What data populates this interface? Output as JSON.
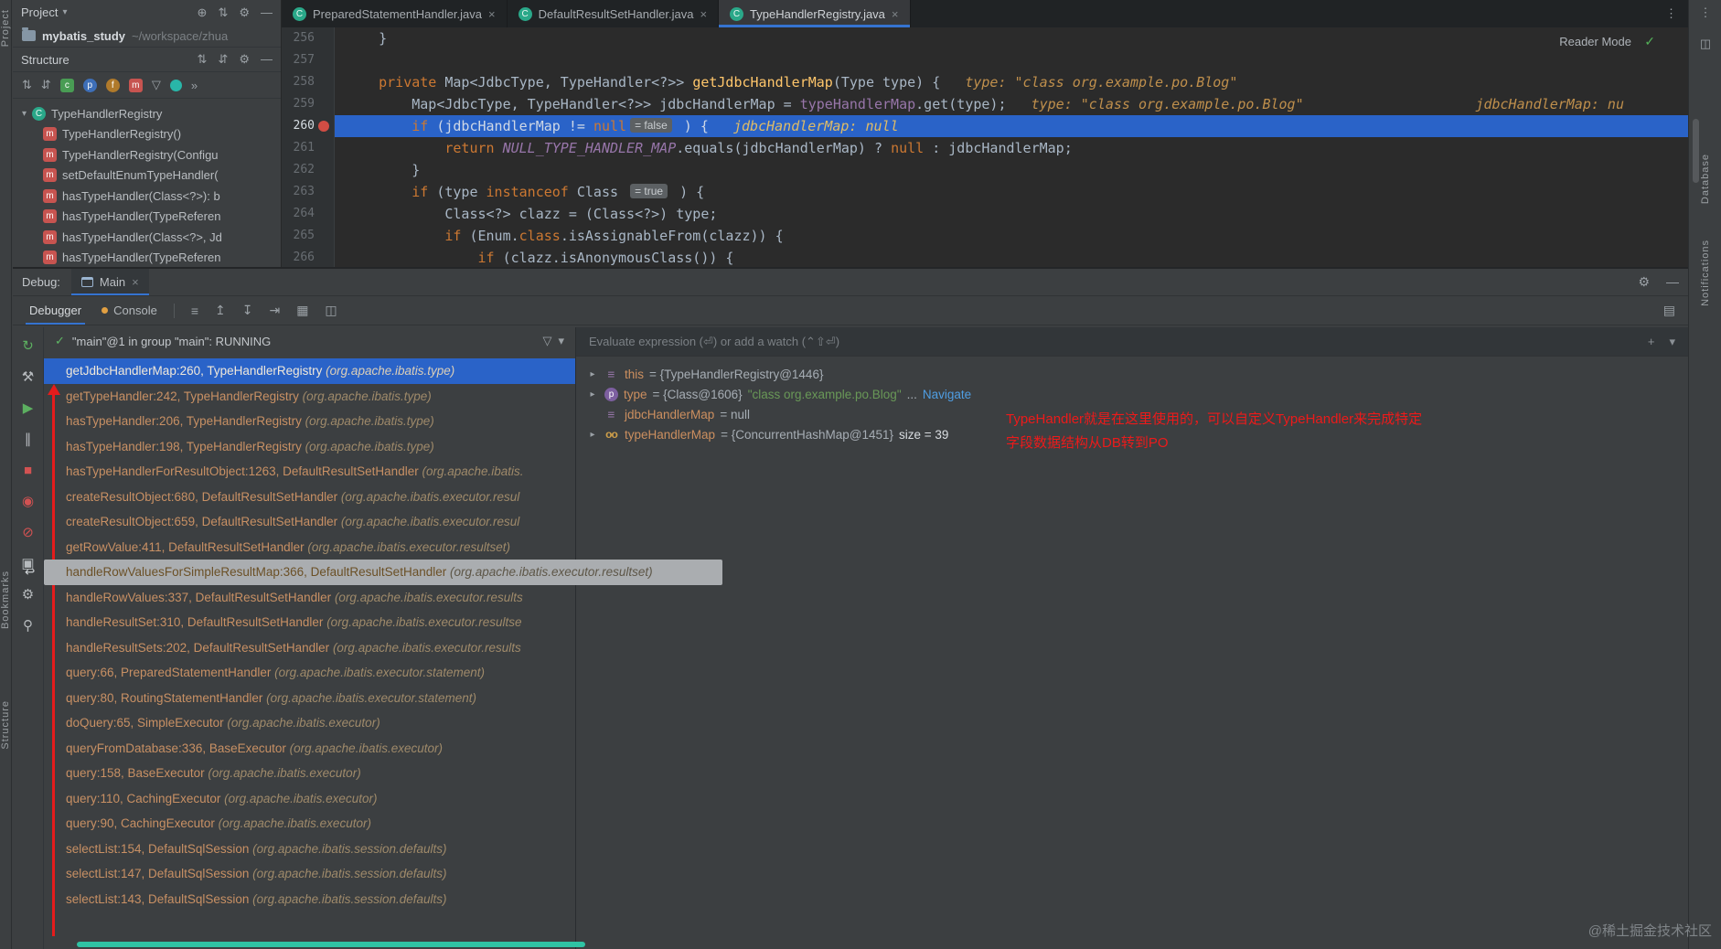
{
  "icons": {
    "caret_down": "▾",
    "caret_right": "▸",
    "crosshair": "⊕",
    "sort": "⇅",
    "sort_alt": "⇵",
    "gear": "⚙",
    "minus": "—",
    "close": "×",
    "dots": "⋮",
    "more": "»",
    "filter": "▽",
    "check": "✓",
    "rerun": "↻",
    "build": "⚒",
    "resume": "▶",
    "pause": "∥",
    "stop": "■",
    "breakpoints": "◉",
    "mute": "⊘",
    "camera": "▣",
    "pin": "⚲",
    "hamburger": "≡",
    "up_bar": "↥",
    "down_bar": "↧",
    "tab_key": "⇥",
    "grid": "▦",
    "split": "◫",
    "layout": "▤",
    "plus": "+",
    "back": "↩",
    "badge_c": "c",
    "badge_p": "p",
    "badge_f": "f",
    "badge_m": "m",
    "class_letter": "C",
    "method_letter": "m",
    "param_letter": "p",
    "watch": "oo",
    "field_bars": "≡"
  },
  "left_stripe": {
    "top_label": "Project",
    "mid_label": "Bookmarks",
    "bottom_label": "Structure"
  },
  "right_stripe": {
    "label_database": "Database",
    "label_notifications": "Notifications"
  },
  "project": {
    "header_title": "Project",
    "root_name": "mybatis_study",
    "root_path": "~/workspace/zhua",
    "structure_title": "Structure",
    "tree_class": "TypeHandlerRegistry",
    "tree": {
      "methods": [
        "TypeHandlerRegistry()",
        "TypeHandlerRegistry(Configu",
        "setDefaultEnumTypeHandler(",
        "hasTypeHandler(Class<?>): b",
        "hasTypeHandler(TypeReferen",
        "hasTypeHandler(Class<?>, Jd",
        "hasTypeHandler(TypeReferen"
      ]
    }
  },
  "tabs": [
    {
      "label": "PreparedStatementHandler.java",
      "active": false
    },
    {
      "label": "DefaultResultSetHandler.java",
      "active": false
    },
    {
      "label": "TypeHandlerRegistry.java",
      "active": true
    }
  ],
  "editor": {
    "reader_mode": "Reader Mode",
    "lines": [
      {
        "num": "256",
        "tokens": [
          [
            "    }",
            "pl"
          ]
        ]
      },
      {
        "num": "257",
        "tokens": []
      },
      {
        "num": "258",
        "tokens": [
          [
            "    ",
            "pl"
          ],
          [
            "private",
            "kw"
          ],
          [
            " Map<JdbcType, TypeHandler<?>> ",
            "pl"
          ],
          [
            "getJdbcHandlerMap",
            "fn"
          ],
          [
            "(Type type) {",
            "pl"
          ],
          [
            "   ",
            "pl"
          ],
          [
            "type: \"class org.example.po.Blog\"",
            "hi"
          ]
        ]
      },
      {
        "num": "259",
        "tokens": [
          [
            "        Map<JdbcType, TypeHandler<?>> jdbcHandlerMap = ",
            "pl"
          ],
          [
            "typeHandlerMap",
            "fd"
          ],
          [
            ".get(type);",
            "pl"
          ],
          [
            "   ",
            "pl"
          ],
          [
            "type: \"class org.example.po.Blog\"",
            "hi"
          ]
        ],
        "rhint": "jdbcHandlerMap: nu"
      },
      {
        "num": "260",
        "sel": true,
        "bp": true,
        "tokens": [
          [
            "        ",
            "pl"
          ],
          [
            "if",
            "kw"
          ],
          [
            " (jdbcHandlerMap != ",
            "pl"
          ],
          [
            "null",
            "kw"
          ],
          [
            "= false",
            "ch"
          ],
          [
            " ) {   ",
            "pl"
          ],
          [
            "jdbcHandlerMap: null",
            "hi"
          ]
        ]
      },
      {
        "num": "261",
        "tokens": [
          [
            "            ",
            "pl"
          ],
          [
            "return",
            "kw"
          ],
          [
            " ",
            "pl"
          ],
          [
            "NULL_TYPE_HANDLER_MAP",
            "sf"
          ],
          [
            ".equals(jdbcHandlerMap) ? ",
            "pl"
          ],
          [
            "null",
            "kw"
          ],
          [
            " : jdbcHandlerMap;",
            "pl"
          ]
        ]
      },
      {
        "num": "262",
        "tokens": [
          [
            "        }",
            "pl"
          ]
        ]
      },
      {
        "num": "263",
        "tokens": [
          [
            "        ",
            "pl"
          ],
          [
            "if",
            "kw"
          ],
          [
            " (type ",
            "pl"
          ],
          [
            "instanceof",
            "kw"
          ],
          [
            " Class ",
            "pl"
          ],
          [
            "= true",
            "ch"
          ],
          [
            " ) {",
            "pl"
          ]
        ]
      },
      {
        "num": "264",
        "tokens": [
          [
            "            Class<?> clazz = (Class<?>) type;",
            "pl"
          ]
        ]
      },
      {
        "num": "265",
        "tokens": [
          [
            "            ",
            "pl"
          ],
          [
            "if",
            "kw"
          ],
          [
            " (Enum.",
            "pl"
          ],
          [
            "class",
            "kw"
          ],
          [
            ".isAssignableFrom(clazz)) {",
            "pl"
          ]
        ]
      },
      {
        "num": "266",
        "tokens": [
          [
            "                ",
            "pl"
          ],
          [
            "if",
            "kw"
          ],
          [
            " (clazz.isAnonymousClass()) {",
            "pl"
          ]
        ]
      }
    ]
  },
  "debug": {
    "label": "Debug:",
    "main_tab": "Main",
    "debugger_tab": "Debugger",
    "console_tab": "Console",
    "thread": "\"main\"@1 in group \"main\": RUNNING",
    "eval_placeholder": "Evaluate expression (⏎) or add a watch (⌃⇧⏎)",
    "frames": [
      {
        "m": "getJdbcHandlerMap:260, TypeHandlerRegistry",
        "p": "(org.apache.ibatis.type)",
        "sel": true
      },
      {
        "m": "getTypeHandler:242, TypeHandlerRegistry",
        "p": "(org.apache.ibatis.type)"
      },
      {
        "m": "hasTypeHandler:206, TypeHandlerRegistry",
        "p": "(org.apache.ibatis.type)"
      },
      {
        "m": "hasTypeHandler:198, TypeHandlerRegistry",
        "p": "(org.apache.ibatis.type)"
      },
      {
        "m": "hasTypeHandlerForResultObject:1263, DefaultResultSetHandler",
        "p": "(org.apache.ibatis."
      },
      {
        "m": "createResultObject:680, DefaultResultSetHandler",
        "p": "(org.apache.ibatis.executor.resul"
      },
      {
        "m": "createResultObject:659, DefaultResultSetHandler",
        "p": "(org.apache.ibatis.executor.resul"
      },
      {
        "m": "getRowValue:411, DefaultResultSetHandler",
        "p": "(org.apache.ibatis.executor.resultset)"
      },
      {
        "m": "handleRowValuesForSimpleResultMap:366, DefaultResultSetHandler",
        "p": "(org.apache.ibatis.executor.resultset)",
        "tooltip": true
      },
      {
        "m": "handleRowValues:337, DefaultResultSetHandler",
        "p": "(org.apache.ibatis.executor.results"
      },
      {
        "m": "handleResultSet:310, DefaultResultSetHandler",
        "p": "(org.apache.ibatis.executor.resultse"
      },
      {
        "m": "handleResultSets:202, DefaultResultSetHandler",
        "p": "(org.apache.ibatis.executor.results"
      },
      {
        "m": "query:66, PreparedStatementHandler",
        "p": "(org.apache.ibatis.executor.statement)"
      },
      {
        "m": "query:80, RoutingStatementHandler",
        "p": "(org.apache.ibatis.executor.statement)"
      },
      {
        "m": "doQuery:65, SimpleExecutor",
        "p": "(org.apache.ibatis.executor)"
      },
      {
        "m": "queryFromDatabase:336, BaseExecutor",
        "p": "(org.apache.ibatis.executor)"
      },
      {
        "m": "query:158, BaseExecutor",
        "p": "(org.apache.ibatis.executor)"
      },
      {
        "m": "query:110, CachingExecutor",
        "p": "(org.apache.ibatis.executor)"
      },
      {
        "m": "query:90, CachingExecutor",
        "p": "(org.apache.ibatis.executor)"
      },
      {
        "m": "selectList:154, DefaultSqlSession",
        "p": "(org.apache.ibatis.session.defaults)"
      },
      {
        "m": "selectList:147, DefaultSqlSession",
        "p": "(org.apache.ibatis.session.defaults)"
      },
      {
        "m": "selectList:143, DefaultSqlSession",
        "p": "(org.apache.ibatis.session.defaults)"
      }
    ],
    "variables": [
      {
        "chev": true,
        "icon": "field",
        "name": "this",
        "parts": [
          {
            "t": " = {TypeHandlerRegistry@1446}",
            "c": "ref"
          }
        ]
      },
      {
        "chev": true,
        "icon": "param",
        "name": "type",
        "parts": [
          {
            "t": " = {Class@1606} ",
            "c": "ref"
          },
          {
            "t": "\"class org.example.po.Blog\"",
            "c": "str"
          },
          {
            "t": " ... ",
            "c": "ref"
          },
          {
            "t": "Navigate",
            "c": "link"
          }
        ]
      },
      {
        "chev": false,
        "icon": "field",
        "name": "jdbcHandlerMap",
        "parts": [
          {
            "t": " = null",
            "c": "ref"
          }
        ]
      },
      {
        "chev": true,
        "icon": "watch",
        "name": "typeHandlerMap",
        "parts": [
          {
            "t": " = {ConcurrentHashMap@1451} ",
            "c": "ref"
          },
          {
            "t": "size = 39",
            "c": "em"
          }
        ]
      }
    ],
    "annotation": {
      "line1": "TypeHandler就是在这里使用的，可以自定义TypeHandler来完成特定",
      "line2": "字段数据结构从DB转到PO"
    }
  },
  "watermark": "@稀土掘金技术社区"
}
